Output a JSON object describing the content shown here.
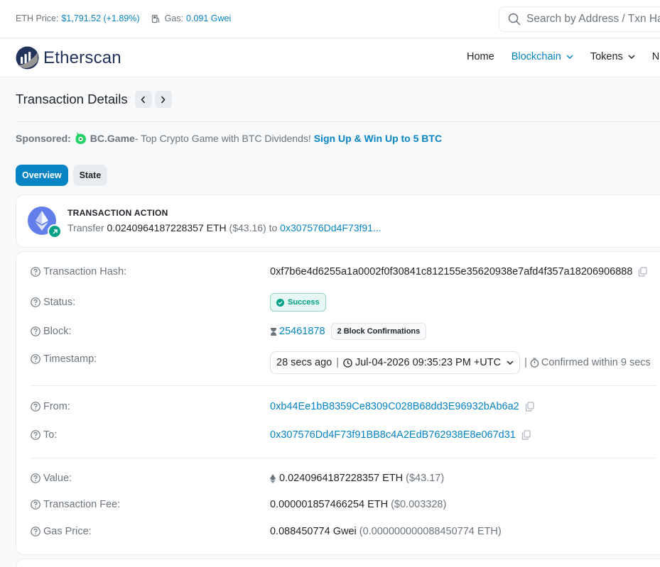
{
  "topbar": {
    "eth_price_label": "ETH Price:",
    "eth_price_value": "$1,791.52 (+1.89%)",
    "gas_label": "Gas:",
    "gas_value": "0.091 Gwei",
    "search_placeholder": "Search by Address / Txn Hash"
  },
  "header": {
    "logo_text": "Etherscan",
    "nav": [
      {
        "label": "Home"
      },
      {
        "label": "Blockchain"
      },
      {
        "label": "Tokens"
      },
      {
        "label": "N"
      }
    ]
  },
  "page": {
    "title": "Transaction Details"
  },
  "sponsored": {
    "label": "Sponsored:",
    "brand": "BC.Game",
    "text": " - Top Crypto Game with BTC Dividends!",
    "cta": "Sign Up & Win Up to 5 BTC"
  },
  "tabs": [
    {
      "label": "Overview"
    },
    {
      "label": "State"
    }
  ],
  "action": {
    "title": "TRANSACTION ACTION",
    "verb": "Transfer",
    "amount": "0.0240964187228357 ETH",
    "usd": "($43.16)",
    "to_word": "to",
    "to_address": "0x307576Dd4F73f91..."
  },
  "details": {
    "tx_hash": {
      "label": "Transaction Hash:",
      "value": "0xf7b6e4d6255a1a0002f0f30841c812155e35620938e7afd4f357a18206906888"
    },
    "status": {
      "label": "Status:",
      "value": "Success"
    },
    "block": {
      "label": "Block:",
      "value": "25461878",
      "confirmations": "2 Block Confirmations"
    },
    "timestamp": {
      "label": "Timestamp:",
      "ago": "28 secs ago",
      "datetime": "Jul-04-2026 09:35:23 PM +UTC",
      "confirmed": "Confirmed within 9 secs"
    },
    "from": {
      "label": "From:",
      "value": "0xb44Ee1bB8359Ce8309C028B68dd3E96932bAb6a2"
    },
    "to": {
      "label": "To:",
      "value": "0x307576Dd4F73f91BB8c4A2EdB762938E8e067d31"
    },
    "value": {
      "label": "Value:",
      "amount": "0.0240964187228357 ETH",
      "usd": "($43.17)"
    },
    "fee": {
      "label": "Transaction Fee:",
      "amount": "0.000001857466254 ETH",
      "usd": "($0.003328)"
    },
    "gas_price": {
      "label": "Gas Price:",
      "amount": "0.088450774 Gwei",
      "eth": "(0.000000000088450774 ETH)"
    }
  }
}
